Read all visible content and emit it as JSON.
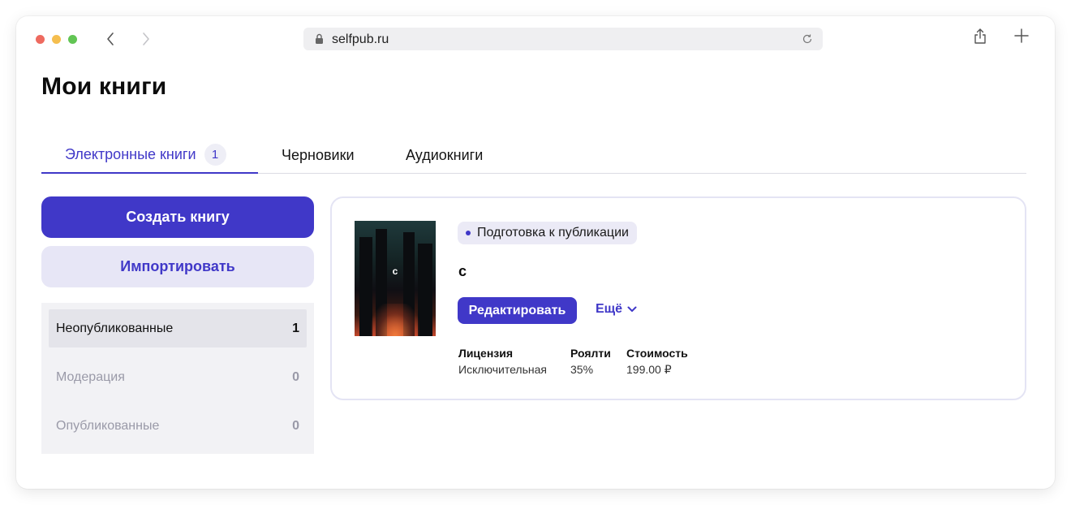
{
  "browser": {
    "url": "selfpub.ru"
  },
  "page": {
    "title": "Мои книги"
  },
  "tabs": [
    {
      "label": "Электронные книги",
      "count": "1"
    },
    {
      "label": "Черновики"
    },
    {
      "label": "Аудиокниги"
    }
  ],
  "actions": {
    "create_label": "Создать книгу",
    "import_label": "Импортировать"
  },
  "filters": [
    {
      "label": "Неопубликованные",
      "count": "1"
    },
    {
      "label": "Модерация",
      "count": "0"
    },
    {
      "label": "Опубликованные",
      "count": "0"
    }
  ],
  "book": {
    "cover_letter": "с",
    "status": "Подготовка к публикации",
    "title": "с",
    "edit_label": "Редактировать",
    "more_label": "Ещё",
    "license_label": "Лицензия",
    "license_value": "Исключительная",
    "royalty_label": "Роялти",
    "royalty_value": "35%",
    "price_label": "Стоимость",
    "price_value": "199.00 ₽"
  },
  "colors": {
    "accent": "#4038c8",
    "accent_light": "#e7e6f6",
    "filters_bg": "#f2f2f5",
    "text_muted": "#9a9aa8"
  },
  "icons": {
    "back": "chevron-left-icon",
    "forward": "chevron-right-icon",
    "lock": "lock-icon",
    "reload": "reload-icon",
    "share": "share-icon",
    "new_tab": "plus-icon",
    "more": "chevron-down-icon"
  }
}
